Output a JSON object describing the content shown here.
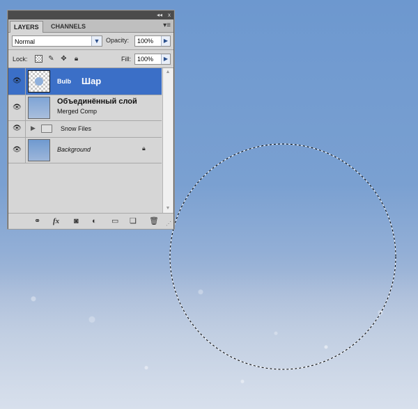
{
  "panel": {
    "collapse_label": "◂◂",
    "close_label": "x",
    "tabs": [
      {
        "label": "LAYERS"
      },
      {
        "label": "CHANNELS"
      }
    ],
    "blend_mode": "Normal",
    "opacity_label": "Opacity:",
    "opacity_value": "100%",
    "lock_label": "Lock:",
    "fill_label": "Fill:",
    "fill_value": "100%",
    "layers": [
      {
        "name": "Bulb",
        "annotation": "Шар",
        "selected": true
      },
      {
        "name": "Объединённый слой",
        "sub": "Merged Comp"
      },
      {
        "name": "Snow Files",
        "type": "group"
      },
      {
        "name": "Background",
        "locked": true
      }
    ],
    "bottom_icons": [
      "link-icon",
      "fx-icon",
      "mask-icon",
      "adjustment-icon",
      "folder-icon",
      "new-layer-icon",
      "trash-icon"
    ],
    "fx_label": "fx"
  },
  "colors": {
    "selection_blue": "#3b6fc7",
    "panel_bg": "#d6d6d6"
  }
}
